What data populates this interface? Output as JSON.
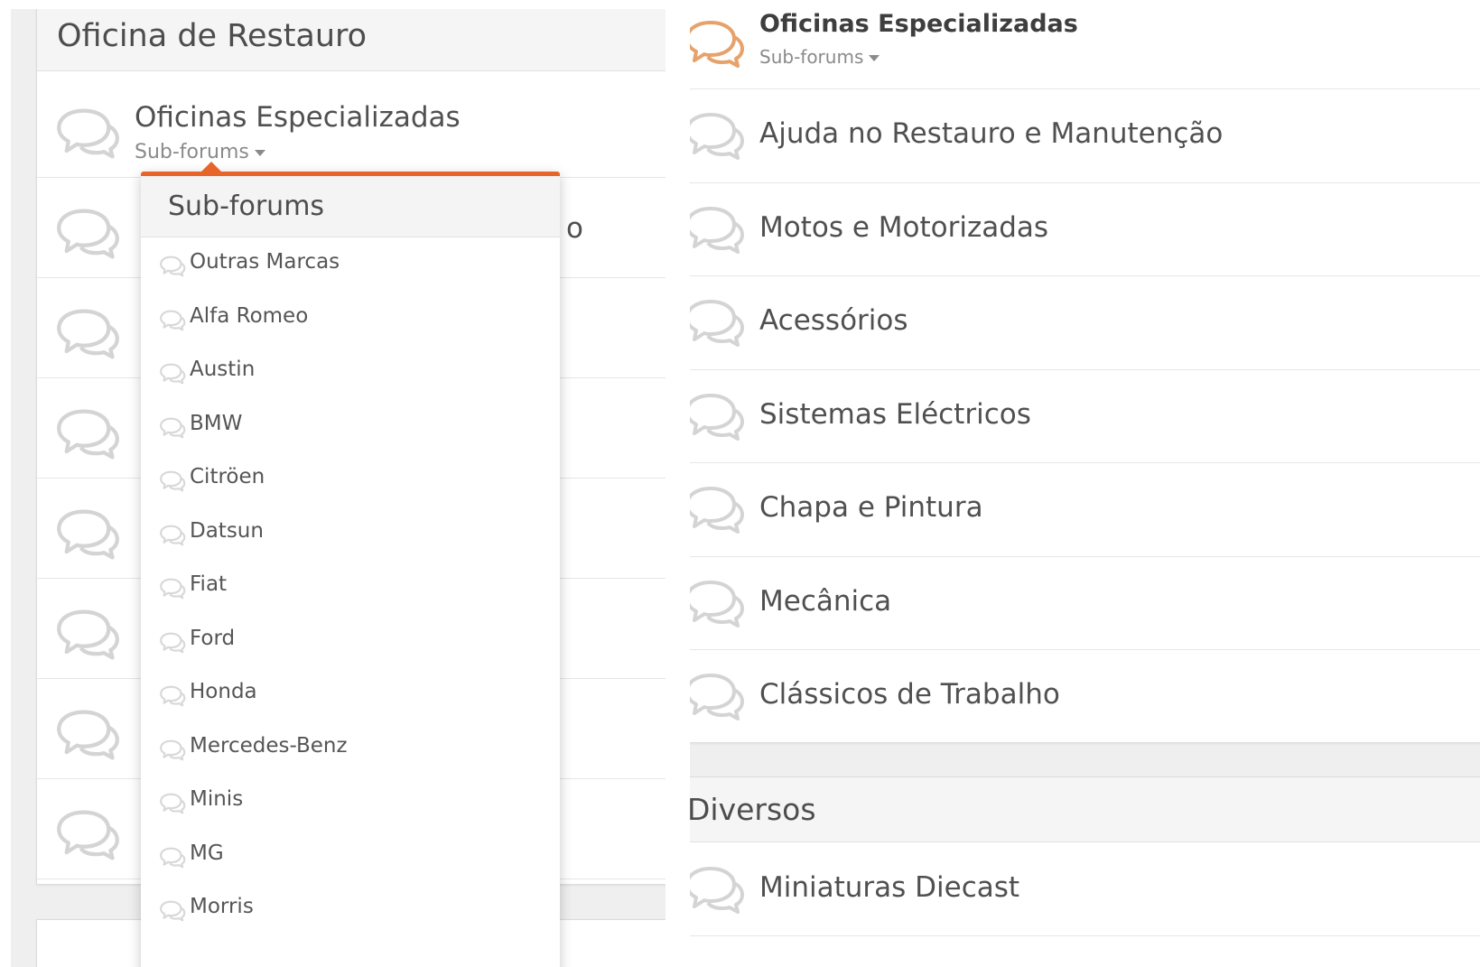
{
  "left": {
    "category_title": "Oficina de Restauro",
    "first_forum": {
      "name": "Oficinas Especializadas",
      "subforums_label": "Sub-forums"
    },
    "partial_text": "o",
    "dropdown": {
      "title": "Sub-forums",
      "items": [
        "Outras Marcas",
        "Alfa Romeo",
        "Austin",
        "BMW",
        "Citröen",
        "Datsun",
        "Fiat",
        "Ford",
        "Honda",
        "Mercedes-Benz",
        "Minis",
        "MG",
        "Morris"
      ]
    }
  },
  "right": {
    "top_forum": {
      "name": "Oficinas Especializadas",
      "subforums_label": "Sub-forums"
    },
    "forums": [
      "Ajuda no Restauro e Manutenção",
      "Motos e Motorizadas",
      "Acessórios",
      "Sistemas Eléctricos",
      "Chapa e Pintura",
      "Mecânica",
      "Clássicos de Trabalho"
    ],
    "category2_title": "Diversos",
    "category2_forums": [
      "Miniaturas Diecast"
    ]
  },
  "colors": {
    "accent": "#e8652a",
    "icon_gray": "#d4d4d4",
    "icon_active": "#e6a26a"
  },
  "icons": {
    "forum": "chat-bubbles-icon"
  }
}
